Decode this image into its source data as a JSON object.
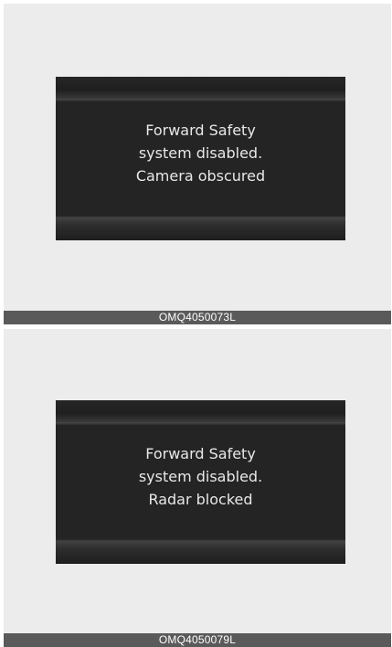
{
  "figures": [
    {
      "message_lines": [
        "Forward Safety",
        "system disabled.",
        "Camera obscured"
      ],
      "caption": "OMQ4050073L"
    },
    {
      "message_lines": [
        "Forward Safety",
        "system disabled.",
        "Radar blocked"
      ],
      "caption": "OMQ4050079L"
    }
  ],
  "colors": {
    "panel_background": "#ececec",
    "screen_background": "#242424",
    "caption_bar": "#5a5a5a",
    "message_text": "#e8e8e8"
  }
}
